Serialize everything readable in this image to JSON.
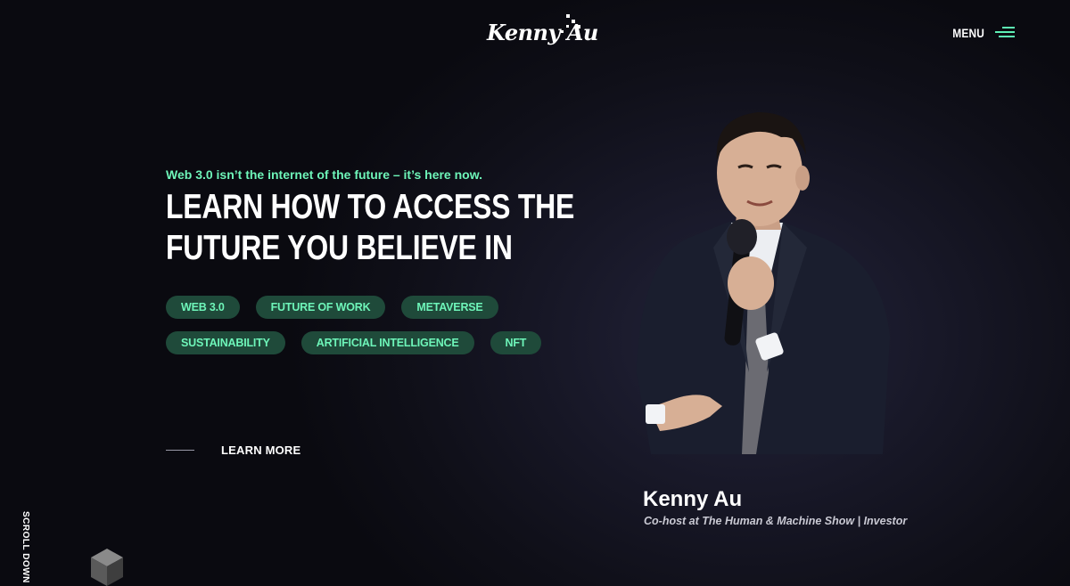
{
  "header": {
    "logo_text": "Kenny Au",
    "menu_label": "MENU"
  },
  "hero": {
    "kicker": "Web 3.0 isn’t the internet of the future – it’s here now.",
    "headline_line1": "LEARN HOW TO ACCESS THE",
    "headline_line2": "FUTURE YOU BELIEVE IN",
    "tags_row1": [
      "WEB 3.0",
      "FUTURE OF WORK",
      "METAVERSE"
    ],
    "tags_row2": [
      "SUSTAINABILITY",
      "ARTIFICIAL INTELLIGENCE",
      "NFT"
    ],
    "learn_more": "LEARN MORE"
  },
  "profile": {
    "name": "Kenny Au",
    "role": "Co-host at The Human & Machine Show | Investor"
  },
  "scroll_label": "SCROLL DOWN",
  "colors": {
    "accent": "#6ef5b9",
    "tag_bg": "#1f4a3a",
    "background": "#0b0b12"
  },
  "icons": [
    "menu-icon",
    "cube-icon",
    "logo-dots-icon"
  ]
}
